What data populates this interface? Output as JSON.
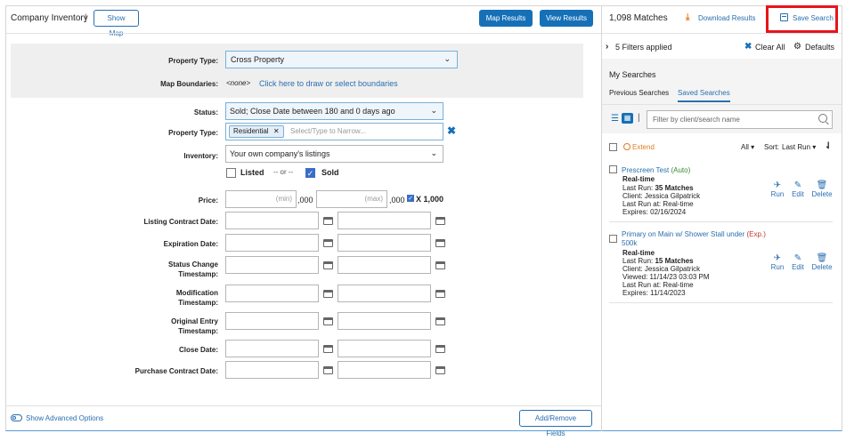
{
  "header": {
    "title": "Company Inventory",
    "separator": "|",
    "show_map": "Show Map",
    "map_results": "Map Results",
    "view_results": "View Results",
    "matches": "1,098 Matches",
    "download": "Download Results",
    "save_search": "Save Search"
  },
  "form": {
    "property_type_label": "Property Type:",
    "property_type_value": "Cross Property",
    "map_boundaries_label": "Map Boundaries:",
    "map_boundaries_none": "<none>",
    "map_boundaries_link": "Click here to draw or select boundaries",
    "status_label": "Status:",
    "status_value": "Sold; Close Date between 180 and 0 days ago",
    "property_type2_label": "Property Type:",
    "property_type2_tag": "Residential",
    "property_type2_placeholder": "Select/Type to Narrow...",
    "inventory_label": "Inventory:",
    "inventory_value": "Your own company's listings",
    "listed_label": "Listed",
    "listed_checked": false,
    "or_text": "-- or --",
    "sold_label": "Sold",
    "sold_checked": true,
    "price_label": "Price:",
    "price_min_placeholder": "(min)",
    "price_max_placeholder": "(max)",
    "price_suffix": ",000",
    "x1000_label": "X 1,000",
    "x1000_checked": true,
    "date_fields": [
      {
        "label": "Listing Contract Date:"
      },
      {
        "label": "Expiration Date:"
      },
      {
        "label": "Status Change Timestamp:"
      },
      {
        "label": "Modification Timestamp:"
      },
      {
        "label": "Original Entry Timestamp:"
      },
      {
        "label": "Close Date:"
      },
      {
        "label": "Purchase Contract Date:"
      }
    ],
    "advanced": "Show Advanced Options",
    "add_remove": "Add/Remove Fields"
  },
  "side": {
    "filters_applied": "5 Filters applied",
    "clear_all": "Clear All",
    "defaults": "Defaults",
    "my_searches": "My Searches",
    "tab_previous": "Previous Searches",
    "tab_saved": "Saved Searches",
    "filter_placeholder": "Filter by client/search name",
    "extend": "Extend",
    "all": "All",
    "sort": "Sort:",
    "sort_value": "Last Run",
    "searches": [
      {
        "name": "Prescreen Test",
        "tag": "(Auto)",
        "name2": "",
        "mode": "Real-time",
        "last_run": "Last Run:",
        "last_run_val": "35 Matches",
        "client": "Client: Jessica Gilpatrick",
        "viewed": "",
        "last_run_at": "Last Run at: Real-time",
        "expires": "Expires: 02/16/2024"
      },
      {
        "name": "Primary on Main w/ Shower Stall under",
        "tag": "(Exp.)",
        "name2": "500k",
        "mode": "Real-time",
        "last_run": "Last Run:",
        "last_run_val": "15 Matches",
        "client": "Client: Jessica Gilpatrick",
        "viewed": "Viewed: 11/14/23 03:03 PM",
        "last_run_at": "Last Run at: Real-time",
        "expires": "Expires: 11/14/2023"
      }
    ],
    "action_run": "Run",
    "action_edit": "Edit",
    "action_delete": "Delete"
  },
  "colors": {
    "accent": "#1670b7",
    "link": "#2a6fb0",
    "highlight": "#e8141b",
    "extend": "#e07b22"
  }
}
